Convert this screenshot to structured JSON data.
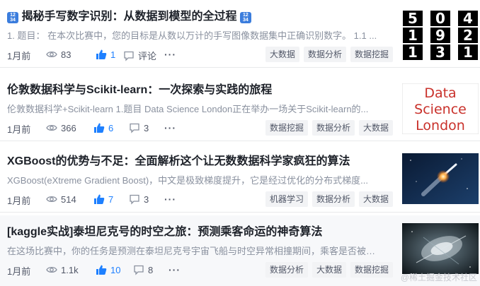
{
  "articles": [
    {
      "title": "揭秘手写数字识别：从数据到模型的全过程",
      "emoji_top": "12",
      "emoji_bottom": "34",
      "abstract": "1. 题目： 在本次比赛中，您的目标是从数以万计的手写图像数据集中正确识别数字。 1.1 ...",
      "time": "1月前",
      "views": "83",
      "likes": "1",
      "comments": "评论",
      "more": "···",
      "tags": [
        "大数据",
        "数据分析",
        "数据挖掘"
      ],
      "thumb_digits": [
        "5",
        "0",
        "4",
        "1",
        "9",
        "2",
        "1",
        "3",
        "1"
      ]
    },
    {
      "title": "伦敦数据科学与Scikit-learn：一次探索与实践的旅程",
      "abstract": "伦敦数据科学+Scikit-learn 1.题目 Data Science London正在举办一场关于Scikit-learn的...",
      "time": "1月前",
      "views": "366",
      "likes": "6",
      "comments": "3",
      "more": "···",
      "tags": [
        "数据挖掘",
        "数据分析",
        "大数据"
      ],
      "thumb_lines": [
        "Data",
        "Science",
        "London"
      ]
    },
    {
      "title": "XGBoost的优势与不足：全面解析这个让无数数据科学家疯狂的算法",
      "abstract": "XGBoost(eXtreme Gradient Boost)，中文是极致梯度提升，它是经过优化的分布式梯度...",
      "time": "1月前",
      "views": "514",
      "likes": "7",
      "comments": "3",
      "more": "···",
      "tags": [
        "机器学习",
        "数据分析",
        "大数据"
      ]
    },
    {
      "title": "[kaggle实战]泰坦尼克号的时空之旅：预测乘客命运的神奇算法",
      "abstract": "在这场比赛中，你的任务是预测在泰坦尼克号宇宙飞船与时空异常相撞期间，乘客是否被运...",
      "time": "1月前",
      "views": "1.1k",
      "likes": "10",
      "comments": "8",
      "more": "···",
      "tags": [
        "数据分析",
        "大数据",
        "数据挖掘"
      ]
    }
  ],
  "watermark": "@稀土掘金技术社区",
  "colors": {
    "accent": "#1e80ff",
    "muted": "#8a919f",
    "tag_bg": "#f2f3f5"
  }
}
